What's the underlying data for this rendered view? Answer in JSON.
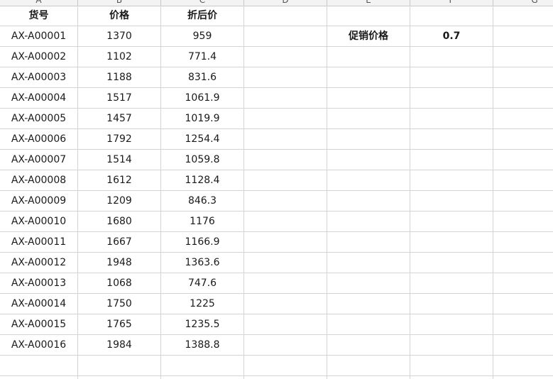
{
  "columns": [
    "A",
    "B",
    "C",
    "D",
    "E",
    "F",
    "G"
  ],
  "header_row": {
    "a": "货号",
    "b": "价格",
    "c": "折后价",
    "d": "",
    "e": "",
    "f": "",
    "g": ""
  },
  "promo": {
    "label": "促销价格",
    "value": "0.7"
  },
  "rows": [
    {
      "sku": "AX-A00001",
      "price": "1370",
      "discounted": "959"
    },
    {
      "sku": "AX-A00002",
      "price": "1102",
      "discounted": "771.4"
    },
    {
      "sku": "AX-A00003",
      "price": "1188",
      "discounted": "831.6"
    },
    {
      "sku": "AX-A00004",
      "price": "1517",
      "discounted": "1061.9"
    },
    {
      "sku": "AX-A00005",
      "price": "1457",
      "discounted": "1019.9"
    },
    {
      "sku": "AX-A00006",
      "price": "1792",
      "discounted": "1254.4"
    },
    {
      "sku": "AX-A00007",
      "price": "1514",
      "discounted": "1059.8"
    },
    {
      "sku": "AX-A00008",
      "price": "1612",
      "discounted": "1128.4"
    },
    {
      "sku": "AX-A00009",
      "price": "1209",
      "discounted": "846.3"
    },
    {
      "sku": "AX-A00010",
      "price": "1680",
      "discounted": "1176"
    },
    {
      "sku": "AX-A00011",
      "price": "1667",
      "discounted": "1166.9"
    },
    {
      "sku": "AX-A00012",
      "price": "1948",
      "discounted": "1363.6"
    },
    {
      "sku": "AX-A00013",
      "price": "1068",
      "discounted": "747.6"
    },
    {
      "sku": "AX-A00014",
      "price": "1750",
      "discounted": "1225"
    },
    {
      "sku": "AX-A00015",
      "price": "1765",
      "discounted": "1235.5"
    },
    {
      "sku": "AX-A00016",
      "price": "1984",
      "discounted": "1388.8"
    }
  ]
}
